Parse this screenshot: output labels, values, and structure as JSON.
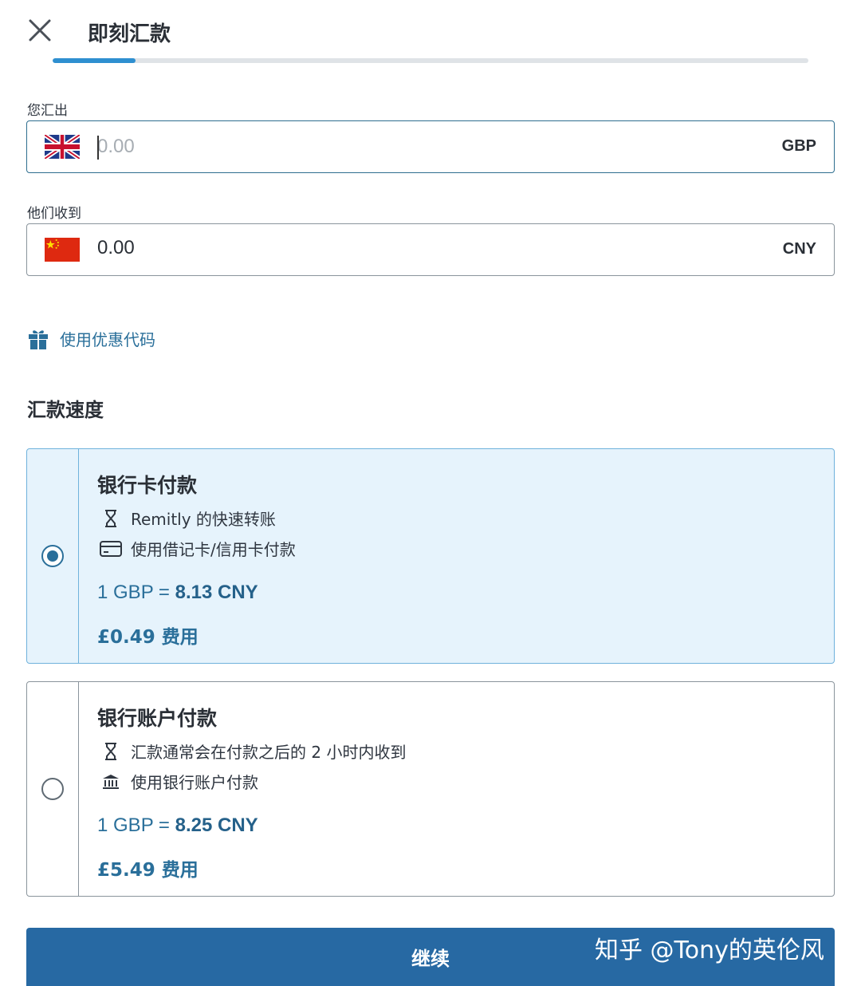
{
  "header": {
    "title": "即刻汇款",
    "close_icon": "close-icon"
  },
  "progress": {
    "value": 0.11
  },
  "send": {
    "label": "您汇出",
    "placeholder": "0.00",
    "currency": "GBP",
    "flag": "uk-flag-icon"
  },
  "receive": {
    "label": "他们收到",
    "value": "0.00",
    "currency": "CNY",
    "flag": "china-flag-icon"
  },
  "promo": {
    "label": "使用优惠代码",
    "icon": "gift-icon"
  },
  "speed": {
    "title": "汇款速度",
    "options": [
      {
        "title": "银行卡付款",
        "line1": "Remitly 的快速转账",
        "line2": "使用借记卡/信用卡付款",
        "rate_prefix": "1 GBP = ",
        "rate_value": "8.13 CNY",
        "fee": "£0.49 费用",
        "selected": true
      },
      {
        "title": "银行账户付款",
        "line1": "汇款通常会在付款之后的 2 小时内收到",
        "line2": "使用银行账户付款",
        "rate_prefix": "1 GBP = ",
        "rate_value": "8.25 CNY",
        "fee": "£5.49 费用",
        "selected": false
      }
    ]
  },
  "continue_label": "继续",
  "watermark": "知乎 @Tony的英伦风",
  "colors": {
    "accent": "#2769a3",
    "link": "#2a6f9a",
    "selected_bg": "#e6f3fc"
  }
}
